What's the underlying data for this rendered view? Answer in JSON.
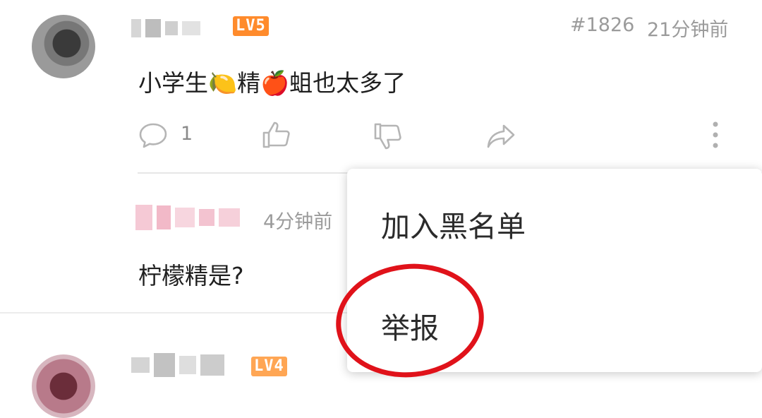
{
  "comment1": {
    "level_badge": "LV5",
    "floor": "#1826",
    "time": "21分钟前",
    "text": "小学生🍋精🍎蛆也太多了",
    "reply_count": "1"
  },
  "reply": {
    "time": "4分钟前",
    "text": "柠檬精是?"
  },
  "comment2": {
    "level_badge": "LV4"
  },
  "menu": {
    "items": [
      "加入黑名单",
      "举报"
    ]
  },
  "colors": {
    "level_badge": "#ff8b2c",
    "highlight_circle": "#e0121a"
  }
}
